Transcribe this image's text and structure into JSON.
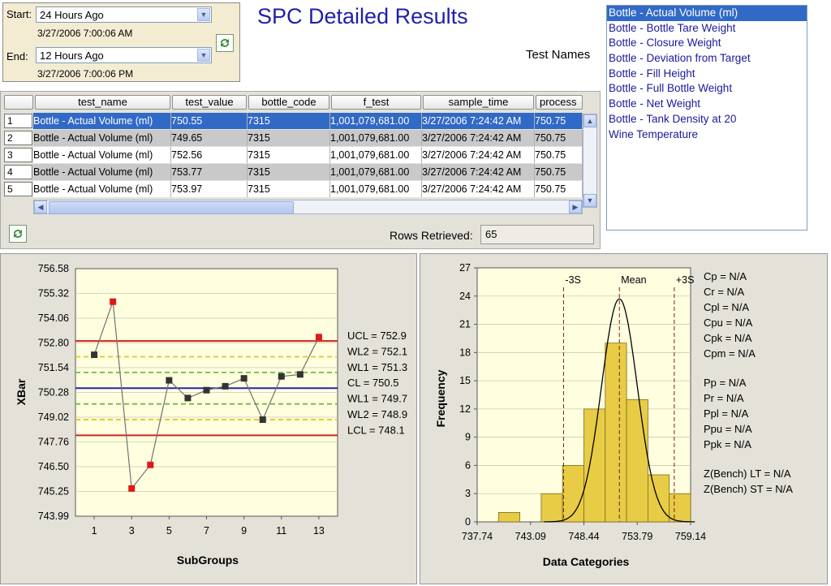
{
  "dates": {
    "start_label": "Start:",
    "start_value": "24 Hours Ago",
    "start_stamp": "3/27/2006 7:00:06 AM",
    "end_label": "End:",
    "end_value": "12 Hours Ago",
    "end_stamp": "3/27/2006 7:00:06 PM"
  },
  "title": "SPC Detailed Results",
  "test_names_label": "Test Names",
  "test_names": [
    "Bottle - Actual Volume (ml)",
    "Bottle - Bottle Tare Weight",
    "Bottle - Closure Weight",
    "Bottle - Deviation from Target",
    "Bottle - Fill Height",
    "Bottle - Full Bottle Weight",
    "Bottle - Net Weight",
    "Bottle - Tank Density at 20",
    "Wine Temperature"
  ],
  "table": {
    "columns": [
      "test_name",
      "test_value",
      "bottle_code",
      "f_test",
      "sample_time",
      "process"
    ],
    "rows": [
      {
        "num": "1",
        "cells": [
          "Bottle - Actual Volume (ml)",
          "750.55",
          "7315",
          "1,001,079,681.00",
          "3/27/2006 7:24:42 AM",
          "750.75"
        ]
      },
      {
        "num": "2",
        "cells": [
          "Bottle - Actual Volume (ml)",
          "749.65",
          "7315",
          "1,001,079,681.00",
          "3/27/2006 7:24:42 AM",
          "750.75"
        ]
      },
      {
        "num": "3",
        "cells": [
          "Bottle - Actual Volume (ml)",
          "752.56",
          "7315",
          "1,001,079,681.00",
          "3/27/2006 7:24:42 AM",
          "750.75"
        ]
      },
      {
        "num": "4",
        "cells": [
          "Bottle - Actual Volume (ml)",
          "753.77",
          "7315",
          "1,001,079,681.00",
          "3/27/2006 7:24:42 AM",
          "750.75"
        ]
      },
      {
        "num": "5",
        "cells": [
          "Bottle - Actual Volume (ml)",
          "753.97",
          "7315",
          "1,001,079,681.00",
          "3/27/2006 7:24:42 AM",
          "750.75"
        ]
      }
    ]
  },
  "rows_retrieved_label": "Rows Retrieved:",
  "rows_retrieved_value": "65",
  "icons": {
    "dropdown": "chevron-down-icon",
    "refresh": "refresh-icon",
    "scroll_up": "arrow-up-icon",
    "scroll_down": "arrow-down-icon",
    "scroll_left": "arrow-left-icon",
    "scroll_right": "arrow-right-icon"
  },
  "colors": {
    "selection": "#3169c6",
    "title": "#1f1fa8",
    "ucl": "#d62020",
    "cl": "#2525b0",
    "wl1": "#6dbf3a",
    "wl2": "#e3c52a",
    "bars": "#e8cc45",
    "ooc_point": "#e01818"
  },
  "chart_data": [
    {
      "type": "line",
      "ylabel": "XBar",
      "xlabel": "SubGroups",
      "x": [
        1,
        2,
        3,
        4,
        5,
        6,
        7,
        8,
        9,
        10,
        11,
        12,
        13
      ],
      "y": [
        752.2,
        754.9,
        745.4,
        746.6,
        750.9,
        750.0,
        750.4,
        750.6,
        751.0,
        748.9,
        751.1,
        751.2,
        753.1
      ],
      "out_of_control": [
        false,
        true,
        true,
        true,
        false,
        false,
        false,
        false,
        false,
        false,
        false,
        false,
        true
      ],
      "ylim": [
        743.99,
        756.58
      ],
      "y_ticks": [
        "756.58",
        "755.32",
        "754.06",
        "752.80",
        "751.54",
        "750.28",
        "749.02",
        "747.76",
        "746.50",
        "745.25",
        "743.99"
      ],
      "x_ticks": [
        "1",
        "3",
        "5",
        "7",
        "9",
        "11",
        "13"
      ],
      "limits": [
        {
          "label": "UCL = 752.9",
          "value": 752.9,
          "kind": "ucl"
        },
        {
          "label": "WL2 = 752.1",
          "value": 752.1,
          "kind": "wl2"
        },
        {
          "label": "WL1 = 751.3",
          "value": 751.3,
          "kind": "wl1"
        },
        {
          "label": "CL = 750.5",
          "value": 750.5,
          "kind": "cl"
        },
        {
          "label": "WL1 = 749.7",
          "value": 749.7,
          "kind": "wl1"
        },
        {
          "label": "WL2 = 748.9",
          "value": 748.9,
          "kind": "wl2"
        },
        {
          "label": "LCL = 748.1",
          "value": 748.1,
          "kind": "ucl"
        }
      ],
      "grid": true
    },
    {
      "type": "bar",
      "ylabel": "Frequency",
      "xlabel": "Data Categories",
      "bins": [
        {
          "from": 737.74,
          "to": 739.88,
          "value": 0
        },
        {
          "from": 739.88,
          "to": 742.02,
          "value": 1
        },
        {
          "from": 742.02,
          "to": 744.16,
          "value": 0
        },
        {
          "from": 744.16,
          "to": 746.3,
          "value": 3
        },
        {
          "from": 746.3,
          "to": 748.44,
          "value": 6
        },
        {
          "from": 748.44,
          "to": 750.58,
          "value": 12
        },
        {
          "from": 750.58,
          "to": 752.72,
          "value": 19
        },
        {
          "from": 752.72,
          "to": 754.86,
          "value": 13
        },
        {
          "from": 754.86,
          "to": 757.0,
          "value": 5
        },
        {
          "from": 757.0,
          "to": 759.14,
          "value": 3
        }
      ],
      "ylim": [
        0,
        27
      ],
      "xlim": [
        737.74,
        759.14
      ],
      "y_ticks": [
        "27",
        "24",
        "21",
        "18",
        "15",
        "12",
        "9",
        "6",
        "3",
        "0"
      ],
      "x_ticks": [
        "737.74",
        "743.09",
        "748.44",
        "753.79",
        "759.14"
      ],
      "markers": [
        {
          "label": "-3S",
          "value": 746.4
        },
        {
          "label": "Mean",
          "value": 752.0
        },
        {
          "label": "+3S",
          "value": 757.5
        }
      ],
      "normal_curve": {
        "mean": 752.0,
        "sd": 1.8,
        "peak": 23.7
      },
      "grid": true
    }
  ],
  "capability_stats": {
    "group1": [
      "Cp = N/A",
      "Cr = N/A",
      "Cpl = N/A",
      "Cpu = N/A",
      "Cpk = N/A",
      "Cpm = N/A"
    ],
    "group2": [
      "Pp = N/A",
      "Pr = N/A",
      "Ppl = N/A",
      "Ppu = N/A",
      "Ppk = N/A"
    ],
    "group3": [
      "Z(Bench) LT = N/A",
      "Z(Bench) ST = N/A"
    ]
  }
}
